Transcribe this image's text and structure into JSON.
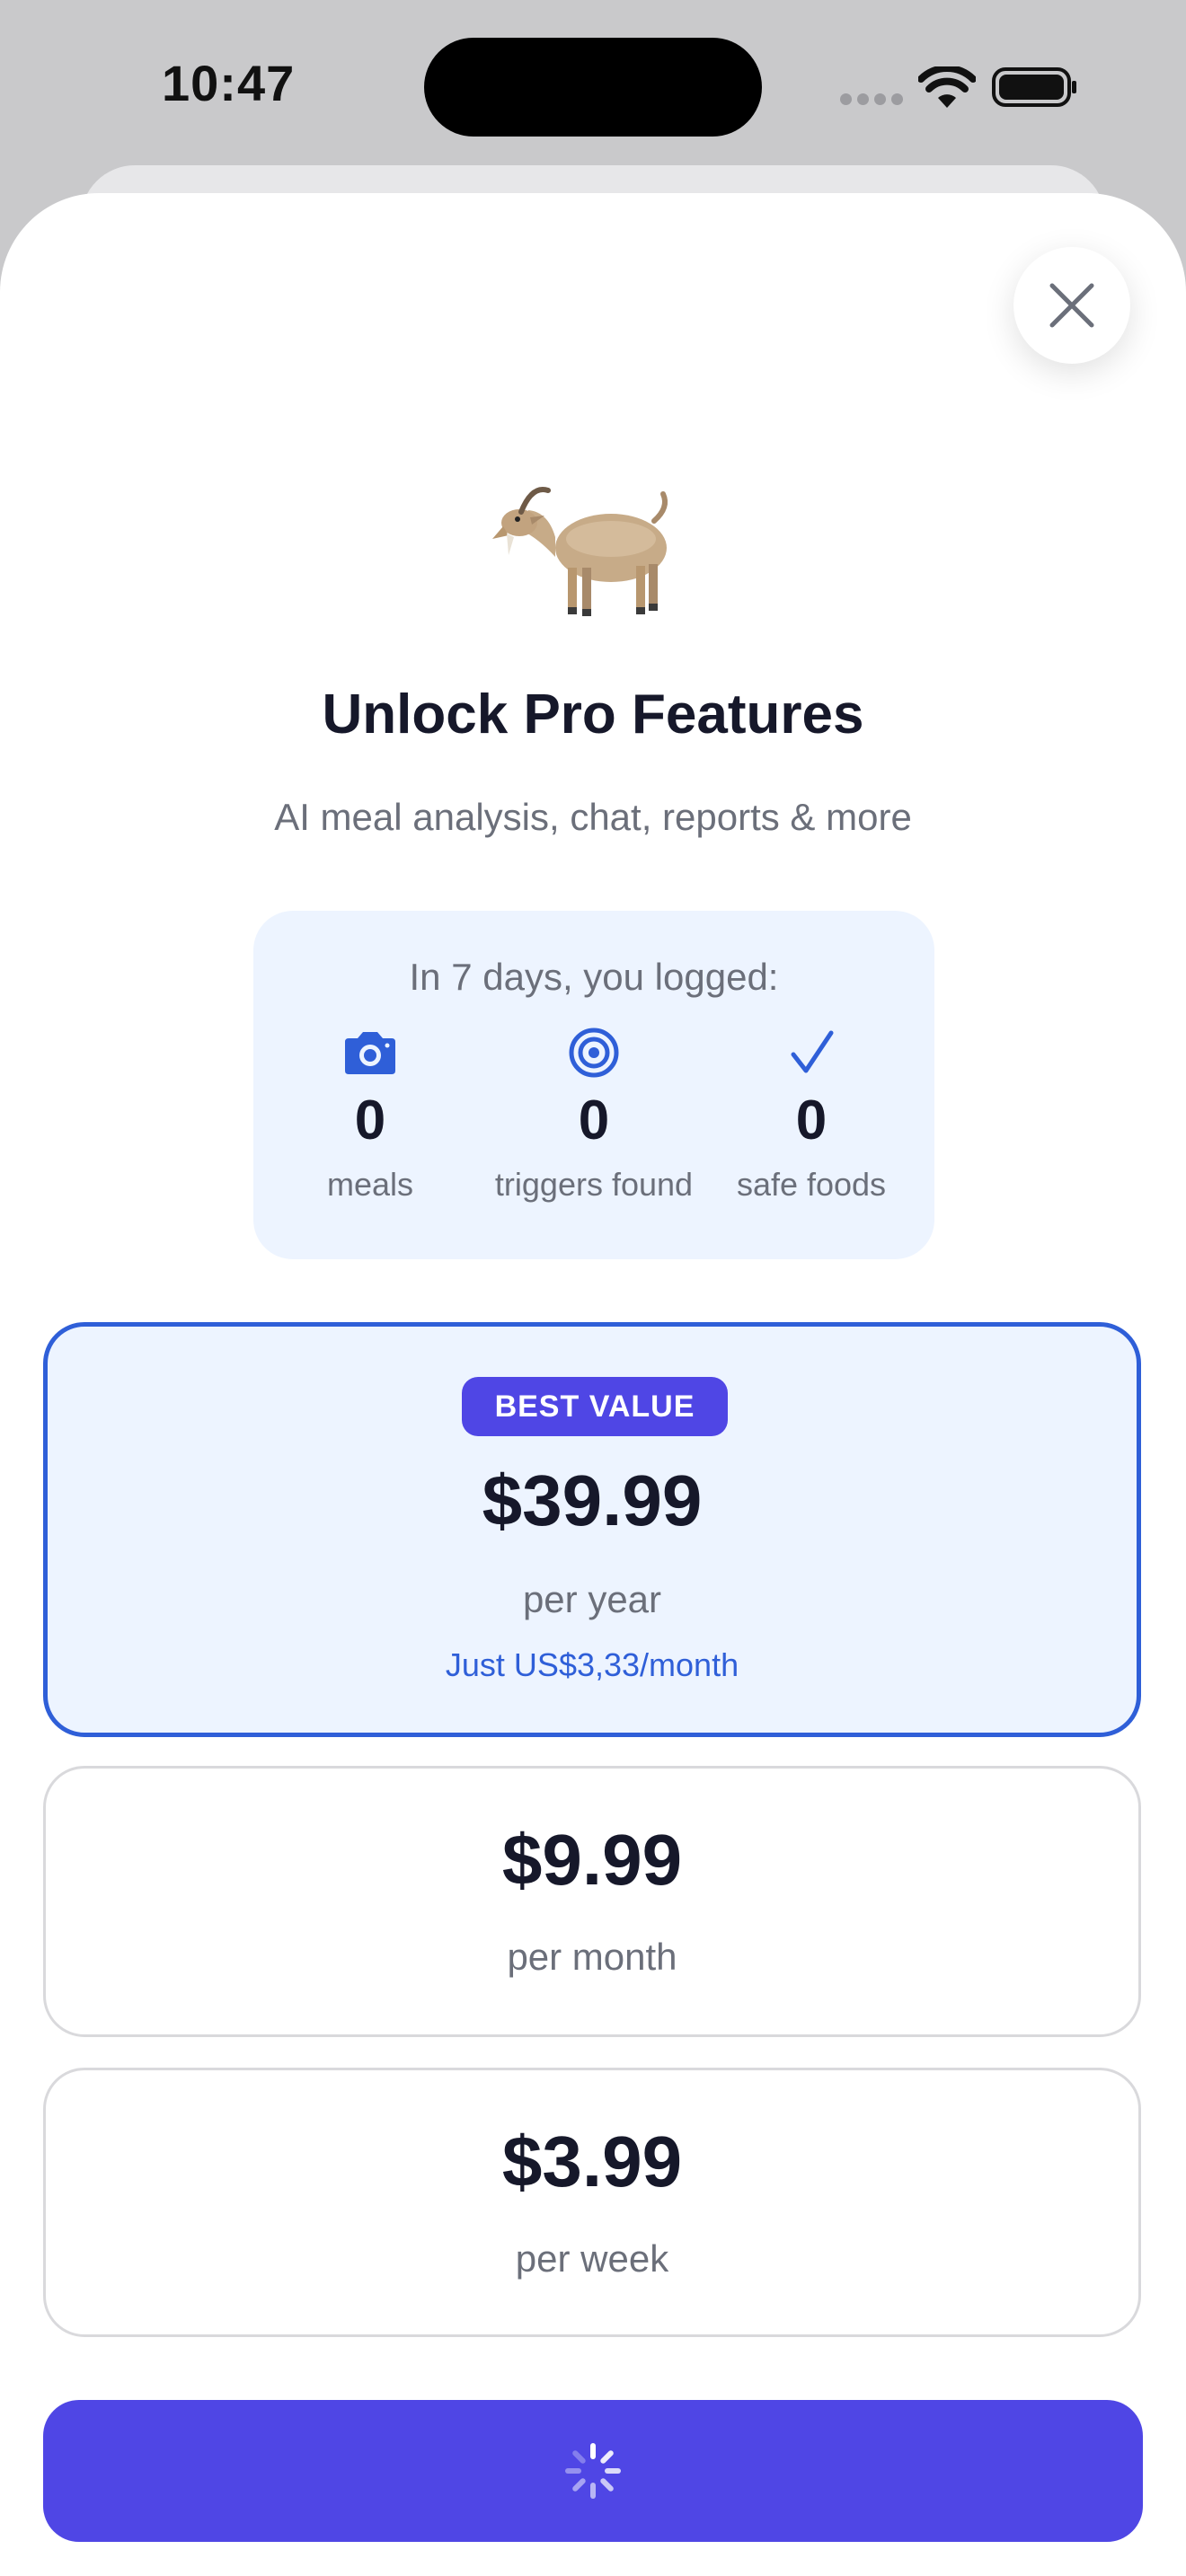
{
  "status_bar": {
    "time": "10:47"
  },
  "header": {
    "close_icon": "close-icon"
  },
  "hero": {
    "icon": "goat-emoji",
    "title": "Unlock Pro Features",
    "subtitle": "AI meal analysis, chat, reports & more"
  },
  "stats": {
    "heading": "In 7 days, you logged:",
    "items": [
      {
        "icon": "camera-icon",
        "value": "0",
        "label": "meals"
      },
      {
        "icon": "target-icon",
        "value": "0",
        "label": "triggers found"
      },
      {
        "icon": "checkmark-icon",
        "value": "0",
        "label": "safe foods"
      }
    ]
  },
  "plans": [
    {
      "badge": "BEST VALUE",
      "price": "$39.99",
      "period": "per year",
      "note": "Just US$3,33/month",
      "selected": true
    },
    {
      "price": "$9.99",
      "period": "per month",
      "selected": false
    },
    {
      "price": "$3.99",
      "period": "per week",
      "selected": false
    }
  ],
  "cta": {
    "icon": "loading-spinner-icon"
  },
  "colors": {
    "accent": "#4f46e5",
    "selected_border": "#2f5fd8",
    "selected_background": "#edf4ff",
    "text_primary": "#16182a",
    "text_secondary": "#6b6f7a"
  }
}
